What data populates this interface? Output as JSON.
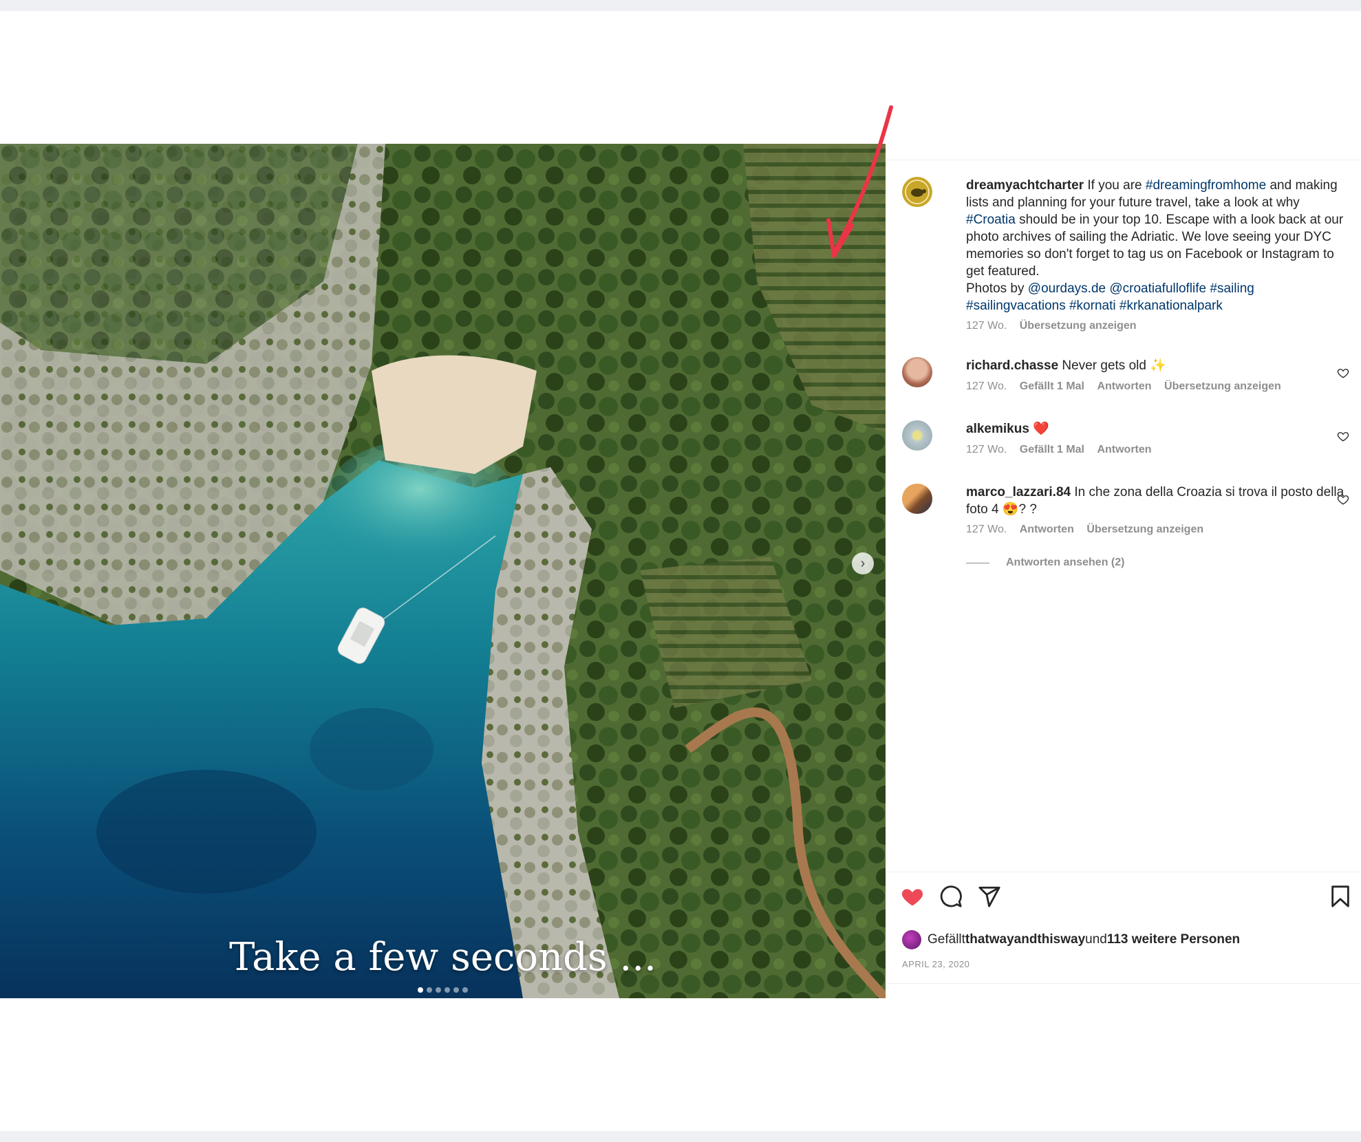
{
  "photo": {
    "caption": "Take a few seconds ...",
    "next_glyph": "›",
    "slides": [
      true,
      false,
      false,
      false,
      false,
      false
    ]
  },
  "post": {
    "author": "dreamyachtcharter",
    "caption_parts": [
      {
        "t": " If you are ",
        "c": "text"
      },
      {
        "t": "#dreamingfromhome",
        "c": "link"
      },
      {
        "t": " and making lists and planning for your future travel, take a look at why ",
        "c": "text"
      },
      {
        "t": "#Croatia",
        "c": "link"
      },
      {
        "t": " should be in your top 10. Escape with a look back at our photo archives of sailing the Adriatic. We love seeing your DYC memories so don't forget to tag us on Facebook or Instagram to get featured.",
        "c": "text"
      },
      {
        "t": "Photos by ",
        "c": "break"
      },
      {
        "t": "@ourdays.de",
        "c": "link"
      },
      {
        "t": " ",
        "c": "text"
      },
      {
        "t": "@croatiafulloflife",
        "c": "link"
      },
      {
        "t": " ",
        "c": "text"
      },
      {
        "t": "#sailing",
        "c": "link"
      },
      {
        "t": " ",
        "c": "text"
      },
      {
        "t": "#sailingvacations",
        "c": "link"
      },
      {
        "t": " ",
        "c": "text"
      },
      {
        "t": "#kornati",
        "c": "link"
      },
      {
        "t": " ",
        "c": "text"
      },
      {
        "t": "#krkanationalpark",
        "c": "link"
      }
    ],
    "age": "127 Wo.",
    "translate": "Übersetzung anzeigen"
  },
  "comments": [
    {
      "user": "richard.chasse",
      "text": " Never gets old ✨",
      "age": "127 Wo.",
      "likes": "Gefällt 1 Mal",
      "reply": "Antworten",
      "translate": "Übersetzung anzeigen"
    },
    {
      "user": "alkemikus",
      "text": " ❤️",
      "age": "127 Wo.",
      "likes": "Gefällt 1 Mal",
      "reply": "Antworten"
    },
    {
      "user": "marco_lazzari.84",
      "text": " In che zona della Croazia si trova il posto della foto 4 😍? ?",
      "age": "127 Wo.",
      "reply": "Antworten",
      "translate": "Übersetzung anzeigen",
      "view_replies": "Antworten ansehen (2)"
    }
  ],
  "footer": {
    "liked_prefix": "Gefällt ",
    "liked_user": "thatwayandthisway",
    "liked_mid": " und ",
    "liked_others": "113 weitere Personen",
    "date": "APRIL 23, 2020"
  },
  "colors": {
    "like_red": "#ed4956",
    "link": "#00376b",
    "annotation_red": "#ea3546"
  }
}
